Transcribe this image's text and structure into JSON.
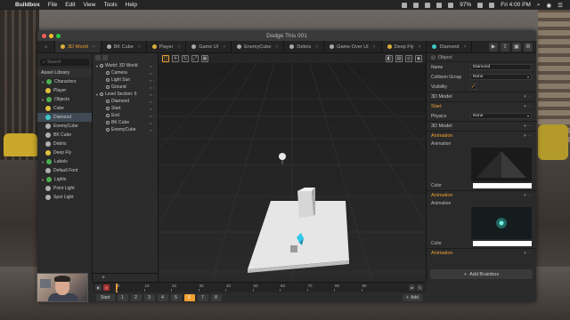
{
  "menubar": {
    "app": "Buildbox",
    "items": [
      "File",
      "Edit",
      "View",
      "Tools",
      "Help"
    ],
    "battery": "97%",
    "clock": "Fri 4:00 PM"
  },
  "window": {
    "title": "Dodge This 001"
  },
  "tabs": [
    {
      "label": "3D World",
      "active": true
    },
    {
      "label": "BK Cube"
    },
    {
      "label": "Player"
    },
    {
      "label": "Game UI"
    },
    {
      "label": "EnemyCube"
    },
    {
      "label": "Debris"
    },
    {
      "label": "Game Over UI"
    },
    {
      "label": "Deep Fly"
    },
    {
      "label": "Diamond"
    }
  ],
  "library": {
    "search_placeholder": "Search",
    "title": "Asset Library",
    "items": [
      {
        "label": "Characters",
        "group": true,
        "color": "#4caf50"
      },
      {
        "label": "Player",
        "color": "#e0c040"
      },
      {
        "label": "Objects",
        "group": true,
        "color": "#4caf50"
      },
      {
        "label": "Cube",
        "color": "#e0c040"
      },
      {
        "label": "Diamond",
        "color": "#40c8c8",
        "selected": true
      },
      {
        "label": "EnemyCube",
        "color": "#b0b0b0"
      },
      {
        "label": "BK Cube",
        "color": "#b0b0b0"
      },
      {
        "label": "Debris",
        "color": "#b0b0b0"
      },
      {
        "label": "Deep Fly",
        "color": "#e0c040"
      },
      {
        "label": "Labels",
        "group": true,
        "color": "#4caf50"
      },
      {
        "label": "Default Font",
        "color": "#b0b0b0"
      },
      {
        "label": "Lights",
        "group": true,
        "color": "#4caf50"
      },
      {
        "label": "Point Light",
        "color": "#b0b0b0"
      },
      {
        "label": "Spot Light",
        "color": "#b0b0b0"
      }
    ]
  },
  "hierarchy": {
    "rows": [
      {
        "label": "World: 3D World",
        "indent": 0
      },
      {
        "label": "Camera",
        "indent": 1
      },
      {
        "label": "Light Sun",
        "indent": 1
      },
      {
        "label": "Ground",
        "indent": 1
      },
      {
        "label": "Level Section: 6",
        "indent": 0
      },
      {
        "label": "Diamond",
        "indent": 1
      },
      {
        "label": "Start",
        "indent": 1
      },
      {
        "label": "End",
        "indent": 1
      },
      {
        "label": "BK Cube",
        "indent": 1
      },
      {
        "label": "EnemyCube",
        "indent": 1
      }
    ],
    "add": "+"
  },
  "inspector": {
    "header": "Object",
    "name_label": "Name",
    "name_value": "Diamond",
    "collision_label": "Collision Group",
    "collision_value": "None",
    "visibility_label": "Visibility",
    "visibility_checked": "✓",
    "model_section": "3D Model",
    "start_section": "Start",
    "physics_label": "Physics",
    "physics_value": "None",
    "model_section2": "3D Model",
    "animation_section": "Animation",
    "animation_label": "Animation",
    "color_label": "Color",
    "animation_section2": "Animation",
    "animation_label2": "Animation",
    "color_label2": "Color",
    "animation_section3": "Animation",
    "add_brainbox": "Add Brainbox"
  },
  "timeline": {
    "ticks": [
      "0",
      "10",
      "20",
      "30",
      "40",
      "50",
      "60",
      "70",
      "80",
      "90"
    ]
  },
  "bottom": {
    "start": "Start",
    "pages": [
      "1",
      "2",
      "3",
      "4",
      "5",
      "6",
      "7",
      "8"
    ],
    "active_page": "6",
    "add_node": "Add"
  }
}
